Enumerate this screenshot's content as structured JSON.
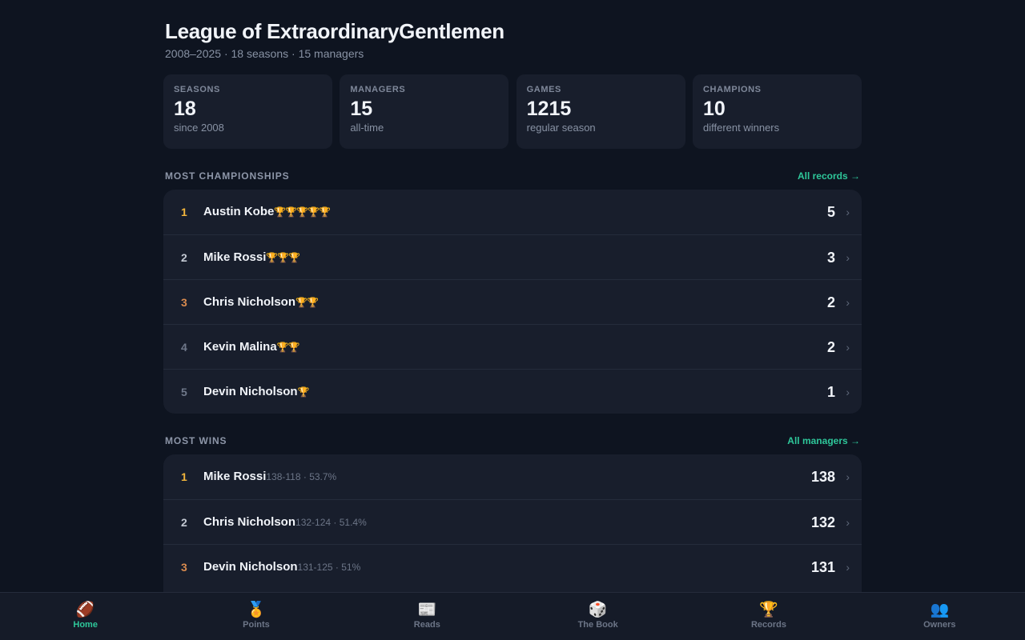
{
  "header": {
    "title": "League of ExtraordinaryGentlemen",
    "subtitle": "2008–2025 · 18 seasons · 15 managers"
  },
  "stats": [
    {
      "label": "SEASONS",
      "value": "18",
      "sub": "since 2008"
    },
    {
      "label": "MANAGERS",
      "value": "15",
      "sub": "all-time"
    },
    {
      "label": "GAMES",
      "value": "1215",
      "sub": "regular season"
    },
    {
      "label": "CHAMPIONS",
      "value": "10",
      "sub": "different winners"
    }
  ],
  "championships": {
    "title": "MOST CHAMPIONSHIPS",
    "link": "All records →",
    "rows": [
      {
        "rank": "1",
        "name": "Austin Kobe",
        "trophies": "🏆🏆🏆🏆🏆",
        "count": "5"
      },
      {
        "rank": "2",
        "name": "Mike Rossi",
        "trophies": "🏆🏆🏆",
        "count": "3"
      },
      {
        "rank": "3",
        "name": "Chris Nicholson",
        "trophies": "🏆🏆",
        "count": "2"
      },
      {
        "rank": "4",
        "name": "Kevin Malina",
        "trophies": "🏆🏆",
        "count": "2"
      },
      {
        "rank": "5",
        "name": "Devin Nicholson",
        "trophies": "🏆",
        "count": "1"
      }
    ]
  },
  "wins": {
    "title": "MOST WINS",
    "link": "All managers →",
    "rows": [
      {
        "rank": "1",
        "name": "Mike Rossi",
        "detail": "138-118 · 53.7%",
        "count": "138"
      },
      {
        "rank": "2",
        "name": "Chris Nicholson",
        "detail": "132-124 · 51.4%",
        "count": "132"
      },
      {
        "rank": "3",
        "name": "Devin Nicholson",
        "detail": "131-125 · 51%",
        "count": "131"
      }
    ]
  },
  "chevron": "›",
  "nav": [
    {
      "icon": "🏈",
      "icon_name": "football-icon",
      "label": "Home",
      "active": true
    },
    {
      "icon": "🏅",
      "icon_name": "medal-icon",
      "label": "Points",
      "active": false
    },
    {
      "icon": "📰",
      "icon_name": "newspaper-icon",
      "label": "Reads",
      "active": false
    },
    {
      "icon": "🎲",
      "icon_name": "dice-icon",
      "label": "The Book",
      "active": false
    },
    {
      "icon": "🏆",
      "icon_name": "trophy-icon",
      "label": "Records",
      "active": false
    },
    {
      "icon": "👥",
      "icon_name": "people-icon",
      "label": "Owners",
      "active": false
    }
  ],
  "colors": {
    "background": "#0e1420",
    "card": "#181e2c",
    "accent": "#2ec79a",
    "rank_gold": "#f3b63c",
    "rank_silver": "#c3c9d3",
    "rank_bronze": "#d98b4f"
  }
}
